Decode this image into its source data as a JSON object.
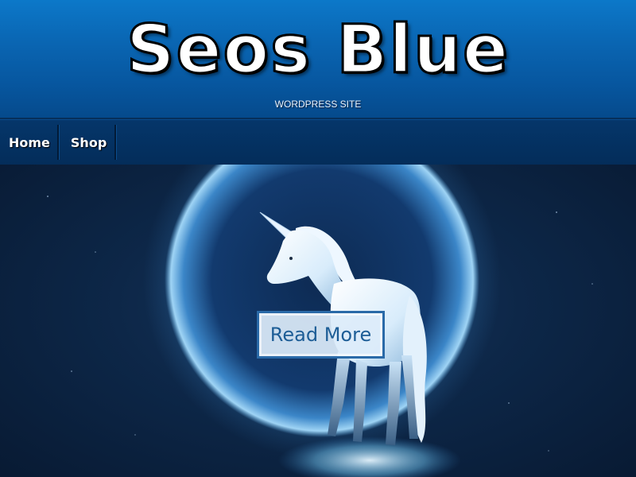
{
  "site": {
    "title": "Seos Blue",
    "tagline": "WORDPRESS SITE"
  },
  "nav": {
    "items": [
      {
        "label": "Home"
      },
      {
        "label": "Shop"
      }
    ]
  },
  "hero": {
    "button_label": "Read More",
    "image_subject": "white unicorn in front of glowing blue planet"
  },
  "colors": {
    "header_blue": "#0a66b3",
    "nav_dark_blue": "#042d5a",
    "button_text": "#1d5d96",
    "button_border": "#2a6aa8"
  }
}
